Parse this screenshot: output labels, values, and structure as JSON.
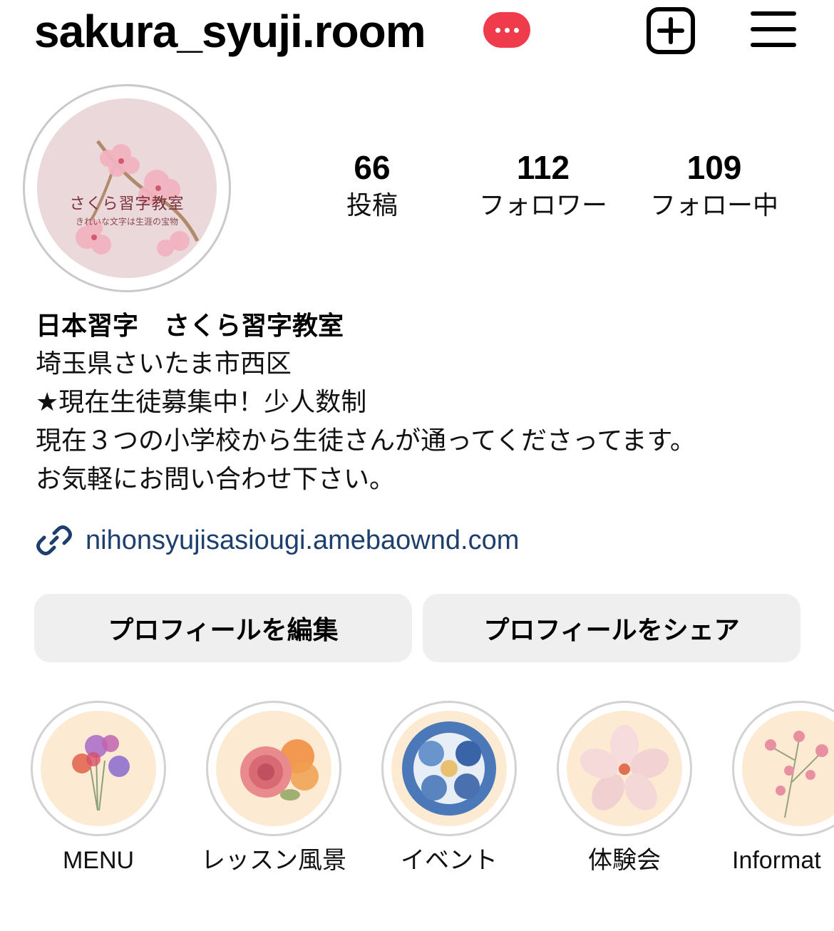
{
  "header": {
    "username": "sakura_syuji.room",
    "notification_icon": "more-dots-icon",
    "create_icon": "plus-square-icon",
    "menu_icon": "hamburger-menu-icon",
    "badge_color": "#ef3b4c"
  },
  "avatar": {
    "title": "さくら習字教室",
    "subtitle": "きれいな文字は生涯の宝物"
  },
  "stats": {
    "posts": {
      "count": "66",
      "label": "投稿"
    },
    "followers": {
      "count": "112",
      "label": "フォロワー"
    },
    "following": {
      "count": "109",
      "label": "フォロー中"
    }
  },
  "bio": {
    "name": "日本習字　さくら習字教室",
    "lines": [
      "埼玉県さいたま市西区",
      "★現在生徒募集中！少人数制",
      "現在３つの小学校から生徒さんが通ってくださってます。",
      "お気軽にお問い合わせ下さい。"
    ],
    "link": "nihonsyujisasiougi.amebaownd.com",
    "link_color": "#1d3f6e"
  },
  "buttons": {
    "edit": "プロフィールを編集",
    "share": "プロフィールをシェア"
  },
  "highlights": [
    {
      "label": "MENU",
      "icon": "sweet-pea-flower-icon"
    },
    {
      "label": "レッスン風景",
      "icon": "rose-flower-icon"
    },
    {
      "label": "イベント",
      "icon": "blue-peony-flower-icon"
    },
    {
      "label": "体験会",
      "icon": "cherry-blossom-flower-icon"
    },
    {
      "label": "Informat",
      "icon": "cherry-branch-icon"
    }
  ]
}
